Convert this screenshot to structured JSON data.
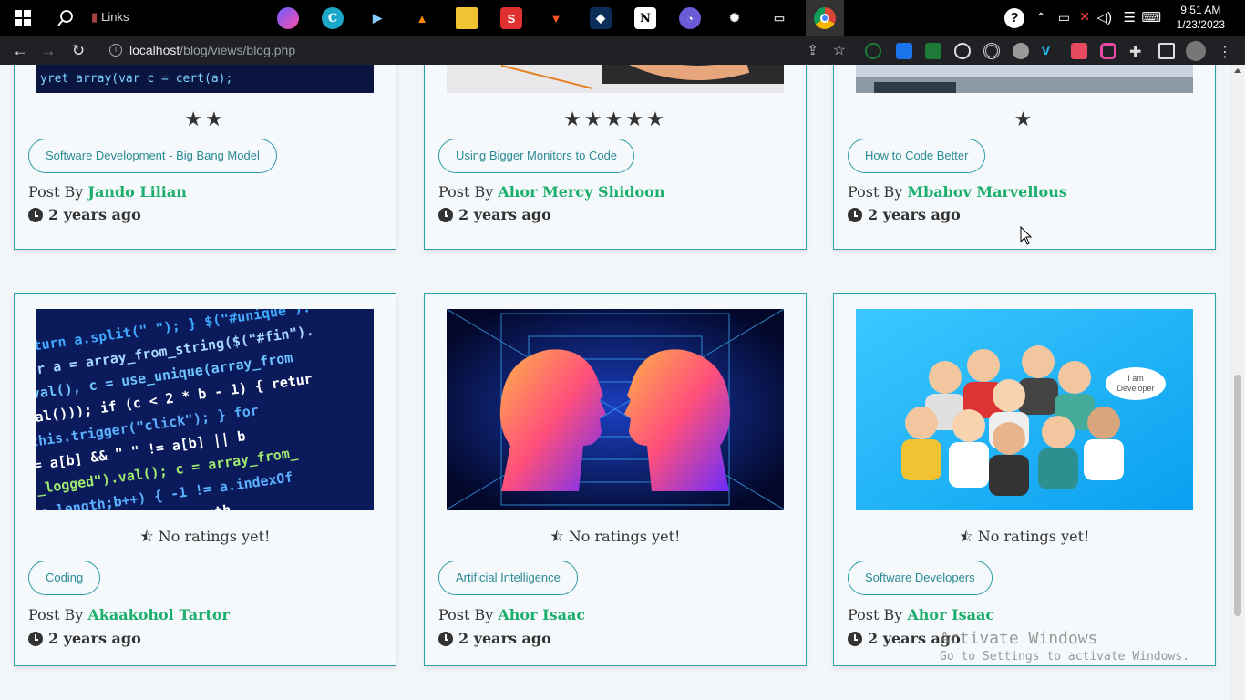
{
  "taskbar": {
    "links_label": "Links",
    "clock_time": "9:51 AM",
    "clock_date": "1/23/2023"
  },
  "browser": {
    "url_host": "localhost",
    "url_path": "/blog/views/blog.php"
  },
  "top_cards": [
    {
      "stars": "★★",
      "tag": "Software Development - Big Bang Model",
      "post_by": "Post By",
      "author": "Jando Lilian",
      "time": "2 years ago"
    },
    {
      "stars": "★★★★★",
      "tag": "Using Bigger Monitors to Code",
      "post_by": "Post By",
      "author": "Ahor Mercy Shidoon",
      "time": "2 years ago"
    },
    {
      "stars": "★",
      "tag": "How to Code Better",
      "post_by": "Post By",
      "author": "Mbabov Marvellous",
      "time": "2 years ago"
    }
  ],
  "bottom_cards": [
    {
      "rating": "No ratings yet!",
      "tag": "Coding",
      "post_by": "Post By",
      "author": "Akaakohol Tartor",
      "time": "2 years ago"
    },
    {
      "rating": "No ratings yet!",
      "tag": "Artificial Intelligence",
      "post_by": "Post By",
      "author": "Ahor Isaac",
      "time": "2 years ago"
    },
    {
      "rating": "No ratings yet!",
      "tag": "Software Developers",
      "post_by": "Post By",
      "author": "Ahor Isaac",
      "time": "2 years ago"
    }
  ],
  "developer_bubble": {
    "line1": "I am",
    "line2": "Developer"
  },
  "watermark": {
    "line1": "Activate Windows",
    "line2": "Go to Settings to activate Windows."
  },
  "colors": {
    "card_border": "#2aa0a8",
    "author_green": "#1bae6c",
    "tag_text": "#2a8a94",
    "page_bg": "#f3f6f9"
  }
}
